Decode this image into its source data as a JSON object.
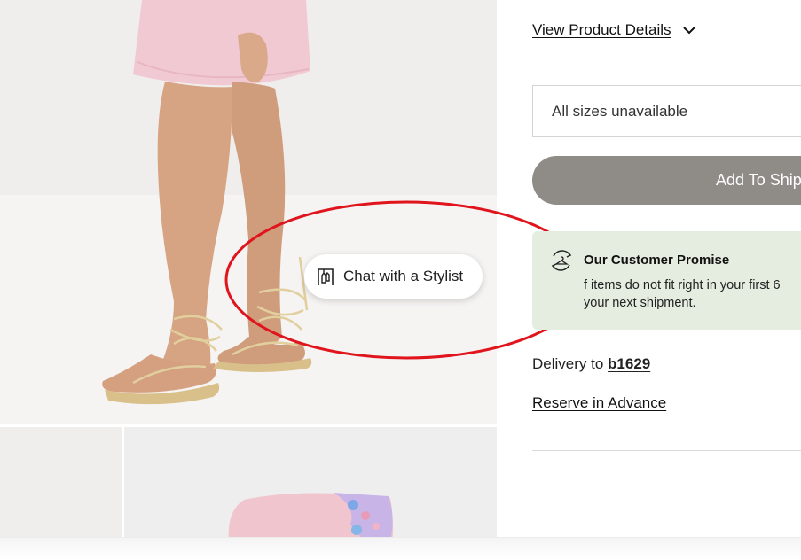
{
  "product": {
    "details_link_label": "View Product Details",
    "size_select_text": "All sizes unavailable",
    "add_button_label": "Add To Ship"
  },
  "promise": {
    "title": "Our Customer Promise",
    "body_line_1": "f items do not fit right in your first 6",
    "body_line_2": "your next shipment."
  },
  "delivery": {
    "prefix": "Delivery to ",
    "zip": "b1629"
  },
  "reserve_label": "Reserve in Advance",
  "chat": {
    "label": "Chat with a Stylist"
  },
  "icons": {
    "chevron": "chevron-down-icon",
    "chat": "clothes-rack-icon",
    "promise": "hanger-refresh-icon"
  },
  "colors": {
    "add_button_bg": "#8f8b87",
    "promise_bg": "#e4ede0",
    "annotation_ring": "#e0141c"
  }
}
